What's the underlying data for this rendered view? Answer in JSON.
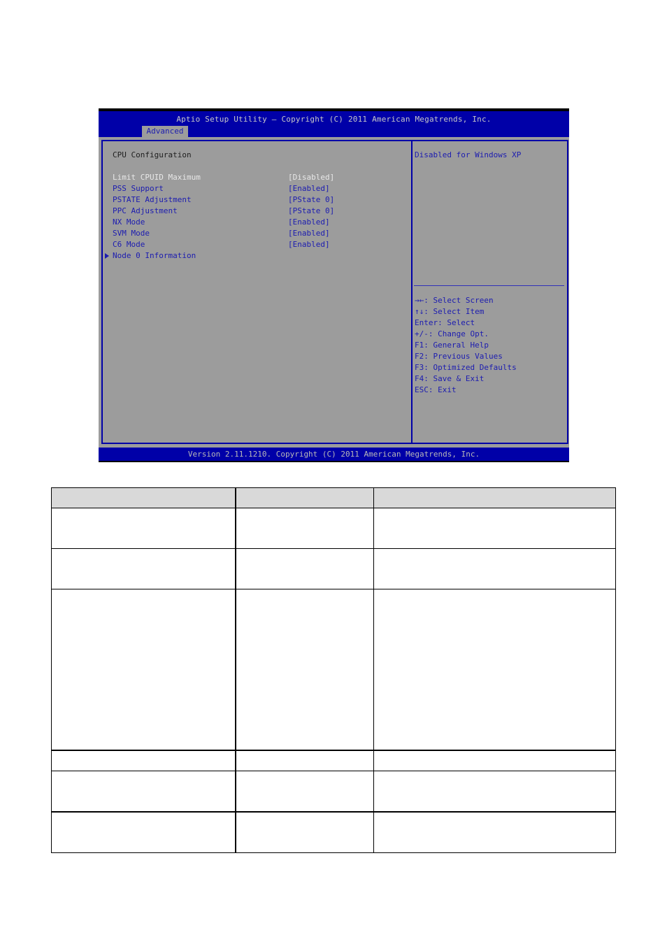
{
  "bios": {
    "title": "Aptio Setup Utility – Copyright (C) 2011 American Megatrends, Inc.",
    "tabs": [
      {
        "label": "Advanced",
        "active": true
      }
    ],
    "section_title": "CPU Configuration",
    "settings": [
      {
        "label": "Limit CPUID Maximum",
        "value": "[Disabled]",
        "selected": true
      },
      {
        "label": "PSS Support",
        "value": "[Enabled]"
      },
      {
        "label": "PSTATE Adjustment",
        "value": "[PState 0]"
      },
      {
        "label": "PPC Adjustment",
        "value": "[PState 0]"
      },
      {
        "label": "NX Mode",
        "value": "[Enabled]"
      },
      {
        "label": "SVM Mode",
        "value": "[Enabled]"
      },
      {
        "label": "C6 Mode",
        "value": "[Enabled]"
      },
      {
        "label": "Node 0 Information",
        "value": "",
        "submenu": true
      }
    ],
    "help_text": "Disabled for Windows XP",
    "key_help": [
      "→←: Select Screen",
      "↑↓: Select Item",
      "Enter: Select",
      "+/-: Change Opt.",
      "F1: General Help",
      "F2: Previous Values",
      "F3: Optimized Defaults",
      "F4: Save & Exit",
      "ESC: Exit"
    ],
    "footer": "Version 2.11.1210. Copyright (C) 2011 American Megatrends, Inc.",
    "colors": {
      "header_blue": "#0000a8",
      "panel_gray": "#9c9c9c",
      "text_blue": "#1c1cb0",
      "selected_text": "#e8e8e8"
    }
  },
  "table": {
    "headers": [
      "",
      "",
      ""
    ],
    "rows": [
      [
        "",
        "",
        ""
      ],
      [
        "",
        "",
        ""
      ],
      [
        "",
        "",
        ""
      ],
      [
        "",
        "",
        ""
      ],
      [
        "",
        "",
        ""
      ],
      [
        "",
        "",
        ""
      ]
    ]
  }
}
